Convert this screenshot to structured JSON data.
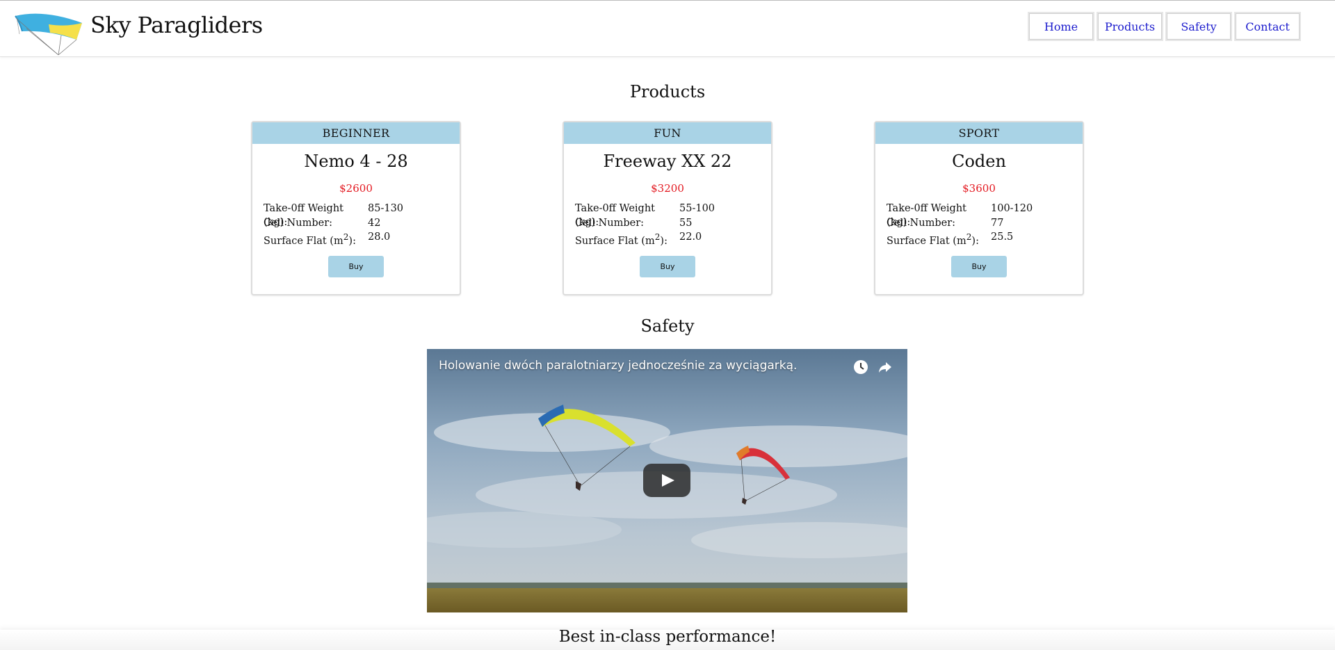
{
  "header": {
    "brand": "Sky Paragliders",
    "nav": [
      "Home",
      "Products",
      "Safety",
      "Contact"
    ]
  },
  "products": {
    "title": "Products",
    "items": [
      {
        "category": "BEGINNER",
        "name": "Nemo 4 - 28",
        "price": "$2600",
        "weight_label": "Take-0ff Weight (kg):",
        "weight": "85-130",
        "cell_label": "Cell Number:",
        "cells": "42",
        "surface_label": "Surface Flat (m",
        "surface_sup": "2",
        "surface_suffix": "):",
        "surface": "28.0",
        "buy": "Buy"
      },
      {
        "category": "FUN",
        "name": "Freeway XX 22",
        "price": "$3200",
        "weight_label": "Take-0ff Weight (kg):",
        "weight": "55-100",
        "cell_label": "Cell Number:",
        "cells": "55",
        "surface_label": "Surface Flat (m",
        "surface_sup": "2",
        "surface_suffix": "):",
        "surface": "22.0",
        "buy": "Buy"
      },
      {
        "category": "SPORT",
        "name": "Coden",
        "price": "$3600",
        "weight_label": "Take-0ff Weight (kg):",
        "weight": "100-120",
        "cell_label": "Cell Number:",
        "cells": "77",
        "surface_label": "Surface Flat (m",
        "surface_sup": "2",
        "surface_suffix": "):",
        "surface": "25.5",
        "buy": "Buy"
      }
    ]
  },
  "safety": {
    "title": "Safety",
    "video_title": "Holowanie dwóch paralotniarzy jednocześnie za wyciągarką.",
    "icons": [
      "clock-icon",
      "share-icon",
      "play-icon"
    ]
  },
  "footer_tagline": "Best in-class performance!",
  "colors": {
    "accent": "#a9d3e6",
    "price": "#e3171f",
    "nav_link": "#1a1acd"
  }
}
